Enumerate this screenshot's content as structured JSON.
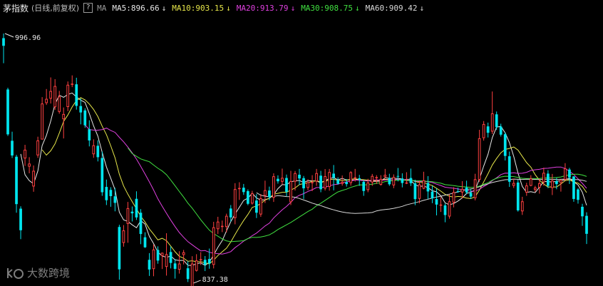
{
  "header": {
    "title": "茅指数",
    "subtitle": "(日线,前复权)",
    "help": "?",
    "ma_label": "MA",
    "ma": [
      {
        "label": "MA5:896.66",
        "color": "#e8e8e8",
        "arrow": "↓"
      },
      {
        "label": "MA10:903.15",
        "color": "#e6e64a",
        "arrow": "↓"
      },
      {
        "label": "MA20:913.79",
        "color": "#e040e0",
        "arrow": "↓"
      },
      {
        "label": "MA30:908.75",
        "color": "#40e040",
        "arrow": "↓"
      },
      {
        "label": "MA60:909.42",
        "color": "#d8d8d8",
        "arrow": "↓"
      }
    ]
  },
  "watermark": "大数跨境",
  "chart_data": {
    "type": "candlestick",
    "ylim": [
      837.38,
      996.96
    ],
    "annotations": {
      "high": "996.96",
      "low": "837.38"
    },
    "colors": {
      "up": "#ff4040",
      "down": "#00e5ee"
    },
    "candles": [
      [
        994.0,
        989.1,
        996.96,
        978.0
      ],
      [
        961.2,
        932.5,
        962.3,
        931.5
      ],
      [
        928.4,
        919.0,
        934.2,
        917.4
      ],
      [
        918.2,
        887.9,
        919.4,
        882.4
      ],
      [
        885.0,
        871.2,
        886.5,
        865.5
      ],
      [
        917.1,
        922.7,
        925.8,
        912.3
      ],
      [
        911.9,
        913.8,
        917.9,
        907.6
      ],
      [
        899.2,
        909.2,
        912.6,
        895.8
      ],
      [
        919.1,
        928.6,
        931.0,
        917.5
      ],
      [
        929.2,
        952.2,
        956.3,
        929.7
      ],
      [
        952.5,
        955.2,
        961.5,
        951.3
      ],
      [
        955.3,
        960.2,
        968.9,
        952.2
      ],
      [
        949.9,
        963.4,
        967.8,
        948.2
      ],
      [
        946.9,
        956.7,
        960.3,
        945.7
      ],
      [
        942.2,
        945.5,
        949.7,
        929.9
      ],
      [
        950.0,
        964.2,
        966.3,
        947.3
      ],
      [
        964.2,
        964.9,
        970.2,
        962.7
      ],
      [
        964.5,
        950.7,
        968.7,
        948.3
      ],
      [
        950.6,
        946.5,
        955.4,
        938.9
      ],
      [
        947.8,
        938.3,
        949.2,
        936.7
      ],
      [
        935.8,
        928.6,
        941.5,
        924.8
      ],
      [
        919.8,
        925.5,
        929.3,
        917.5
      ],
      [
        925.2,
        917.9,
        928.7,
        915.2
      ],
      [
        917.4,
        895.5,
        921.5,
        893.2
      ],
      [
        898.9,
        890.4,
        903.6,
        887.3
      ],
      [
        897.0,
        893.0,
        898.7,
        886.2
      ],
      [
        892.9,
        888.7,
        898.3,
        883.3
      ],
      [
        873.3,
        846.2,
        874.7,
        839.6
      ],
      [
        863.1,
        871.1,
        874.5,
        860.7
      ],
      [
        875.3,
        885.3,
        889.3,
        863.2
      ],
      [
        883.1,
        882.0,
        886.4,
        876.8
      ],
      [
        891.3,
        879.4,
        896.1,
        877.8
      ],
      [
        882.4,
        868.8,
        884.7,
        862.3
      ],
      [
        866.7,
        860.3,
        869.9,
        859.9
      ],
      [
        852.3,
        846.1,
        856.6,
        842.0
      ],
      [
        846.4,
        858.9,
        862.1,
        841.8
      ],
      [
        858.6,
        851.8,
        860.9,
        849.8
      ],
      [
        854.8,
        856.8,
        856.9,
        846.4
      ],
      [
        847.8,
        855.9,
        869.3,
        842.2
      ],
      [
        857.3,
        850.3,
        860.8,
        846.8
      ],
      [
        850.0,
        846.5,
        852.8,
        840.3
      ],
      [
        846.0,
        849.9,
        857.8,
        843.5
      ],
      [
        855.4,
        857.1,
        858.6,
        849.4
      ],
      [
        846.9,
        840.0,
        851.4,
        838.1
      ],
      [
        835.0,
        849.9,
        854.6,
        837.4
      ],
      [
        845.3,
        851.9,
        855.9,
        844.8
      ],
      [
        852.2,
        852.7,
        857.2,
        849.0
      ],
      [
        852.3,
        849.2,
        854.7,
        845.1
      ],
      [
        852.8,
        849.9,
        859.5,
        846.6
      ],
      [
        849.1,
        873.1,
        876.6,
        846.8
      ],
      [
        871.9,
        876.7,
        879.8,
        868.8
      ],
      [
        873.3,
        874.0,
        877.4,
        870.0
      ],
      [
        873.3,
        880.4,
        881.8,
        869.8
      ],
      [
        885.1,
        879.4,
        887.3,
        876.7
      ],
      [
        879.0,
        897.5,
        901.3,
        875.0
      ],
      [
        897.5,
        898.2,
        901.9,
        890.6
      ],
      [
        898.4,
        895.6,
        900.8,
        893.8
      ],
      [
        896.2,
        888.1,
        897.3,
        887.2
      ],
      [
        888.3,
        894.8,
        896.4,
        887.6
      ],
      [
        890.2,
        882.4,
        894.4,
        879.0
      ],
      [
        881.3,
        891.6,
        894.4,
        879.8
      ],
      [
        893.2,
        896.8,
        902.9,
        888.6
      ],
      [
        896.6,
        892.3,
        899.1,
        890.3
      ],
      [
        892.0,
        905.7,
        907.6,
        889.3
      ],
      [
        904.1,
        902.5,
        906.3,
        901.0
      ],
      [
        902.2,
        904.7,
        910.6,
        900.4
      ],
      [
        904.6,
        895.8,
        906.8,
        893.0
      ],
      [
        889.2,
        902.6,
        909.2,
        887.3
      ],
      [
        902.3,
        907.7,
        909.1,
        896.6
      ],
      [
        906.7,
        904.3,
        910.4,
        900.1
      ],
      [
        904.5,
        898.0,
        905.9,
        891.2
      ],
      [
        898.3,
        901.9,
        903.8,
        896.8
      ],
      [
        901.9,
        902.0,
        906.4,
        896.2
      ],
      [
        902.4,
        907.7,
        910.4,
        899.6
      ],
      [
        906.1,
        897.4,
        909.2,
        895.5
      ],
      [
        897.9,
        905.8,
        910.3,
        896.6
      ],
      [
        898.9,
        908.4,
        910.4,
        896.5
      ],
      [
        907.4,
        904.7,
        912.9,
        896.7
      ],
      [
        903.4,
        900.9,
        905.1,
        900.4
      ],
      [
        900.9,
        902.0,
        906.2,
        899.7
      ],
      [
        902.0,
        900.7,
        903.9,
        899.1
      ],
      [
        901.4,
        908.3,
        908.9,
        899.7
      ],
      [
        904.9,
        905.0,
        910.4,
        902.3
      ],
      [
        904.4,
        903.4,
        906.6,
        899.6
      ],
      [
        902.1,
        896.3,
        903.2,
        893.2
      ],
      [
        896.9,
        901.7,
        904.1,
        895.5
      ],
      [
        901.8,
        905.9,
        907.2,
        899.6
      ],
      [
        904.8,
        905.1,
        906.4,
        900.8
      ],
      [
        900.3,
        904.0,
        906.4,
        899.7
      ],
      [
        905.2,
        906.6,
        910.4,
        904.3
      ],
      [
        904.6,
        900.6,
        907.3,
        899.6
      ],
      [
        899.9,
        905.2,
        906.9,
        898.1
      ],
      [
        905.9,
        905.6,
        911.0,
        902.4
      ],
      [
        904.3,
        901.4,
        907.6,
        898.6
      ],
      [
        901.6,
        901.7,
        908.3,
        900.7
      ],
      [
        904.6,
        901.3,
        910.6,
        899.5
      ],
      [
        901.2,
        891.1,
        903.5,
        887.2
      ],
      [
        891.3,
        900.5,
        902.8,
        888.4
      ],
      [
        897.8,
        903.1,
        908.6,
        897.4
      ],
      [
        901.4,
        896.0,
        905.8,
        891.1
      ],
      [
        895.9,
        891.6,
        899.7,
        888.5
      ],
      [
        891.2,
        887.6,
        897.9,
        880.7
      ],
      [
        887.4,
        887.6,
        892.4,
        882.9
      ],
      [
        887.1,
        880.9,
        888.3,
        876.3
      ],
      [
        880.0,
        889.7,
        894.2,
        878.6
      ],
      [
        888.9,
        895.6,
        898.7,
        885.8
      ],
      [
        896.1,
        895.7,
        898.4,
        895.2
      ],
      [
        895.4,
        897.6,
        902.6,
        891.5
      ],
      [
        898.5,
        895.4,
        902.9,
        894.2
      ],
      [
        895.1,
        892.7,
        897.5,
        891.2
      ],
      [
        891.7,
        903.8,
        907.3,
        890.3
      ],
      [
        903.5,
        930.0,
        935.4,
        902.2
      ],
      [
        930.1,
        939.1,
        941.0,
        928.5
      ],
      [
        937.6,
        933.5,
        940.0,
        930.5
      ],
      [
        934.3,
        945.9,
        959.9,
        932.7
      ],
      [
        945.3,
        937.1,
        947.1,
        935.3
      ],
      [
        937.4,
        932.3,
        939.3,
        931.1
      ],
      [
        932.6,
        918.7,
        933.8,
        915.8
      ],
      [
        918.5,
        902.2,
        921.5,
        898.9
      ],
      [
        899.6,
        901.4,
        904.2,
        898.2
      ],
      [
        901.7,
        883.9,
        903.5,
        883.1
      ],
      [
        883.3,
        889.7,
        892.6,
        881.0
      ],
      [
        895.3,
        899.8,
        901.5,
        893.2
      ],
      [
        899.6,
        904.3,
        906.4,
        899.3
      ],
      [
        897.0,
        898.5,
        899.6,
        895.7
      ],
      [
        898.5,
        901.3,
        904.2,
        894.6
      ],
      [
        901.9,
        907.9,
        911.2,
        899.7
      ],
      [
        907.4,
        899.6,
        909.6,
        898.1
      ],
      [
        898.2,
        902.9,
        907.2,
        893.7
      ],
      [
        902.6,
        900.7,
        904.7,
        897.4
      ],
      [
        901.4,
        903.3,
        903.6,
        895.9
      ],
      [
        903.5,
        910.7,
        914.1,
        902.9
      ],
      [
        910.0,
        904.9,
        911.1,
        900.8
      ],
      [
        905.6,
        891.2,
        905.8,
        889.4
      ],
      [
        897.3,
        890.6,
        898.1,
        888.2
      ],
      [
        886.2,
        880.1,
        888.1,
        874.0
      ],
      [
        880.4,
        868.9,
        882.7,
        862.4
      ]
    ]
  }
}
